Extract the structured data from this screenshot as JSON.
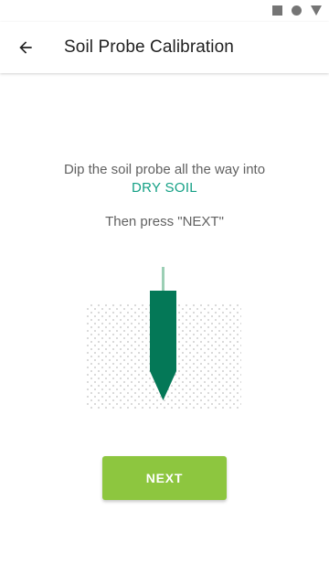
{
  "status_bar": {
    "icons": [
      "square-icon",
      "circle-icon",
      "triangle-icon"
    ]
  },
  "app_bar": {
    "back_icon": "arrow-left-icon",
    "title": "Soil Probe Calibration"
  },
  "main": {
    "instruction_line1": "Dip the soil probe all the way into",
    "instruction_highlight": "DRY SOIL",
    "instruction_line2": "Then press \"NEXT\"",
    "next_label": "NEXT"
  },
  "colors": {
    "highlight": "#14a085",
    "probe": "#047857",
    "probe_wire": "#9ccfb5",
    "button": "#8dc63f",
    "soil_dots": "#cfcfcf"
  }
}
